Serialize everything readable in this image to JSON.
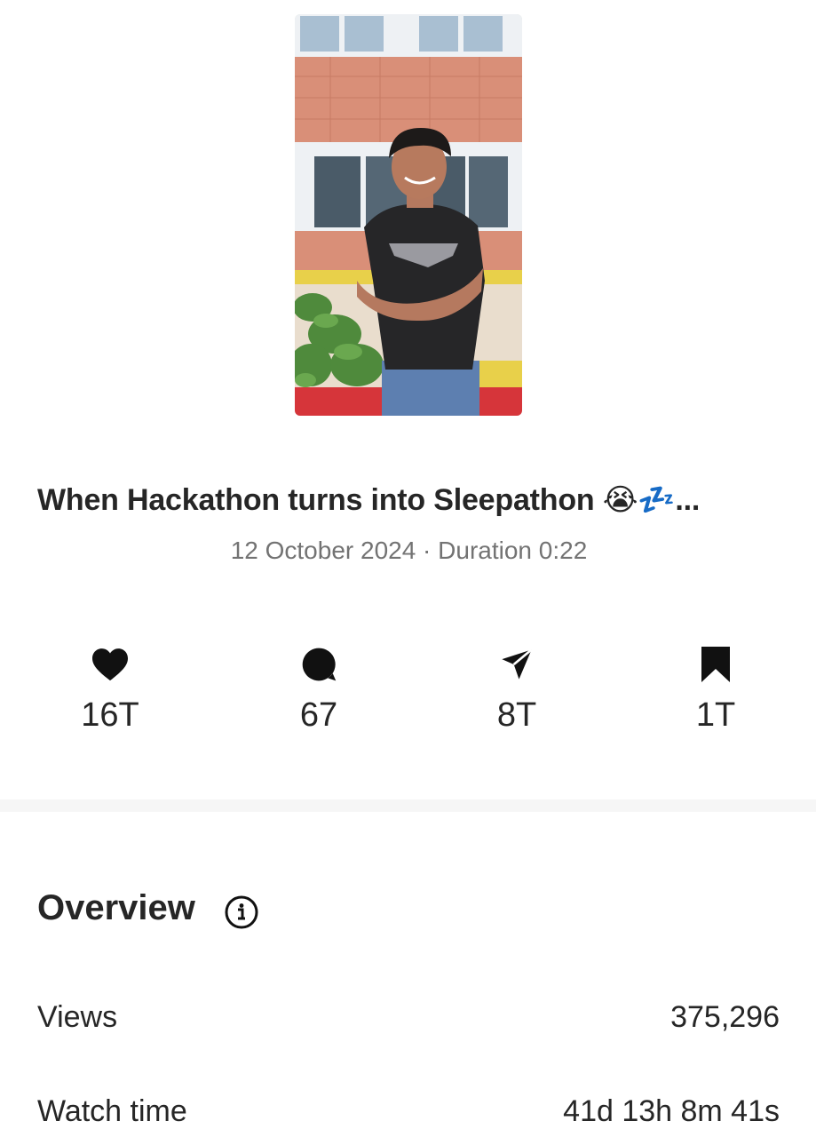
{
  "post": {
    "caption": "When Hackathon turns into Sleepathon 😭💤...",
    "date": "12 October 2024",
    "separator": " · ",
    "duration_label": "Duration",
    "duration": "0:22"
  },
  "stats": {
    "likes": {
      "icon": "heart-icon",
      "value": "16T"
    },
    "comments": {
      "icon": "comment-icon",
      "value": "67"
    },
    "shares": {
      "icon": "send-icon",
      "value": "8T"
    },
    "saves": {
      "icon": "bookmark-icon",
      "value": "1T"
    }
  },
  "overview": {
    "title": "Overview",
    "rows": [
      {
        "label": "Views",
        "value": "375,296"
      },
      {
        "label": "Watch time",
        "value": "41d 13h 8m 41s"
      }
    ]
  },
  "colors": {
    "text": "#262626",
    "muted": "#737373",
    "divider": "#f6f6f6"
  }
}
